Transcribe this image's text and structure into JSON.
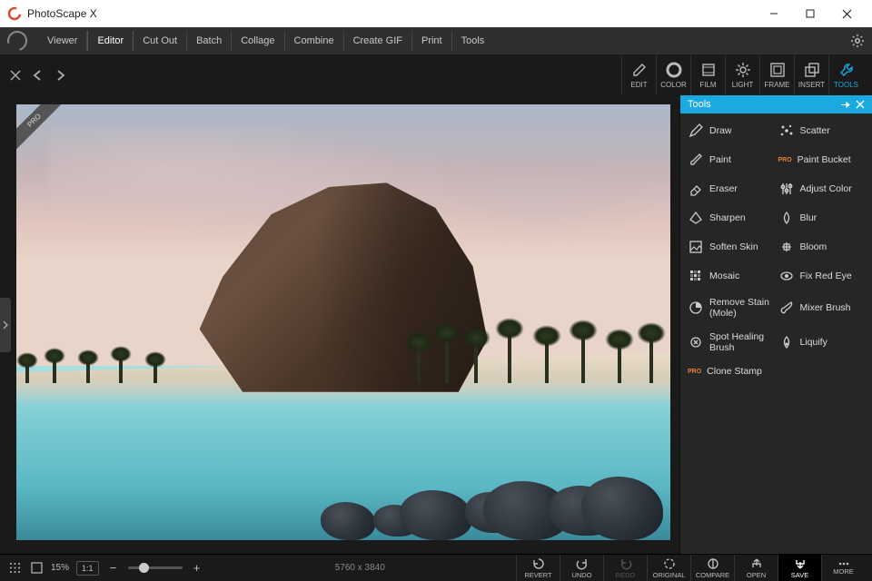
{
  "window": {
    "title": "PhotoScape X"
  },
  "menu": {
    "items": [
      "Viewer",
      "Editor",
      "Cut Out",
      "Batch",
      "Collage",
      "Combine",
      "Create GIF",
      "Print",
      "Tools"
    ],
    "active": "Editor"
  },
  "edit_tabs": [
    {
      "id": "edit",
      "label": "EDIT"
    },
    {
      "id": "color",
      "label": "COLOR"
    },
    {
      "id": "film",
      "label": "FILM"
    },
    {
      "id": "light",
      "label": "LIGHT"
    },
    {
      "id": "frame",
      "label": "FRAME"
    },
    {
      "id": "insert",
      "label": "INSERT"
    },
    {
      "id": "tools",
      "label": "TOOLS",
      "active": true
    }
  ],
  "pro_ribbon": "PRO",
  "panel": {
    "title": "Tools",
    "tools": [
      {
        "label": "Draw"
      },
      {
        "label": "Scatter"
      },
      {
        "label": "Paint"
      },
      {
        "label": "Paint Bucket",
        "pro": true
      },
      {
        "label": "Eraser"
      },
      {
        "label": "Adjust Color"
      },
      {
        "label": "Sharpen"
      },
      {
        "label": "Blur"
      },
      {
        "label": "Soften Skin"
      },
      {
        "label": "Bloom"
      },
      {
        "label": "Mosaic"
      },
      {
        "label": "Fix Red Eye"
      },
      {
        "label": "Remove Stain (Mole)"
      },
      {
        "label": "Mixer Brush"
      },
      {
        "label": "Spot Healing Brush"
      },
      {
        "label": "Liquify"
      },
      {
        "label": "Clone Stamp",
        "pro": true,
        "full": true
      }
    ]
  },
  "status": {
    "zoom_pct": "15%",
    "fit": "1:1",
    "dimensions": "5760 x 3840",
    "actions": [
      {
        "id": "revert",
        "label": "REVERT"
      },
      {
        "id": "undo",
        "label": "UNDO"
      },
      {
        "id": "redo",
        "label": "REDO",
        "disabled": true
      },
      {
        "id": "original",
        "label": "ORIGINAL"
      },
      {
        "id": "compare",
        "label": "COMPARE"
      },
      {
        "id": "open",
        "label": "OPEN"
      },
      {
        "id": "save",
        "label": "SAVE",
        "highlight": true
      },
      {
        "id": "more",
        "label": "MORE"
      }
    ]
  }
}
